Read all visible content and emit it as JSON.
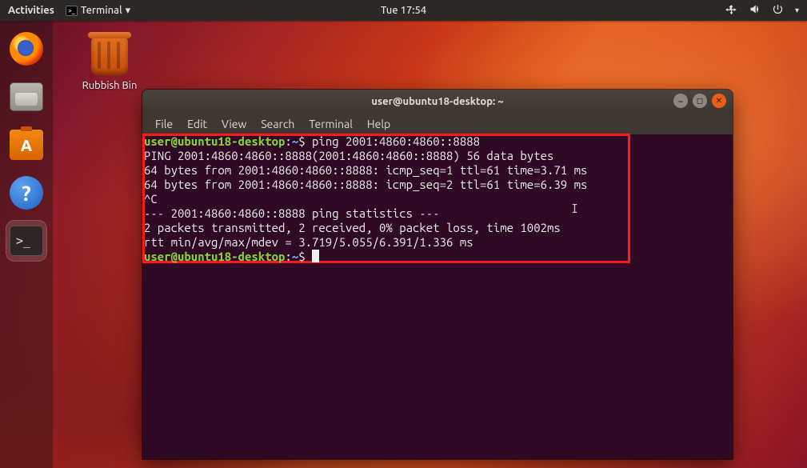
{
  "topbar": {
    "activities": "Activities",
    "app_label": "Terminal",
    "clock": "Tue 17:54"
  },
  "desktop": {
    "rubbish_bin": "Rubbish Bin"
  },
  "dock": {
    "firefox": "Firefox",
    "files": "Files",
    "software": "Ubuntu Software",
    "help": "Help",
    "terminal": "Terminal"
  },
  "window": {
    "title": "user@ubuntu18-desktop: ~",
    "menu": {
      "file": "File",
      "edit": "Edit",
      "view": "View",
      "search": "Search",
      "terminal": "Terminal",
      "help": "Help"
    },
    "prompt": {
      "user": "user@ubuntu18-desktop",
      "colon": ":",
      "path": "~",
      "dollar": "$"
    },
    "command": "ping 2001:4860:4860::8888",
    "output": [
      "PING 2001:4860:4860::8888(2001:4860:4860::8888) 56 data bytes",
      "64 bytes from 2001:4860:4860::8888: icmp_seq=1 ttl=61 time=3.71 ms",
      "64 bytes from 2001:4860:4860::8888: icmp_seq=2 ttl=61 time=6.39 ms",
      "^C",
      "--- 2001:4860:4860::8888 ping statistics ---",
      "2 packets transmitted, 2 received, 0% packet loss, time 1002ms",
      "rtt min/avg/max/mdev = 3.719/5.055/6.391/1.336 ms"
    ]
  }
}
